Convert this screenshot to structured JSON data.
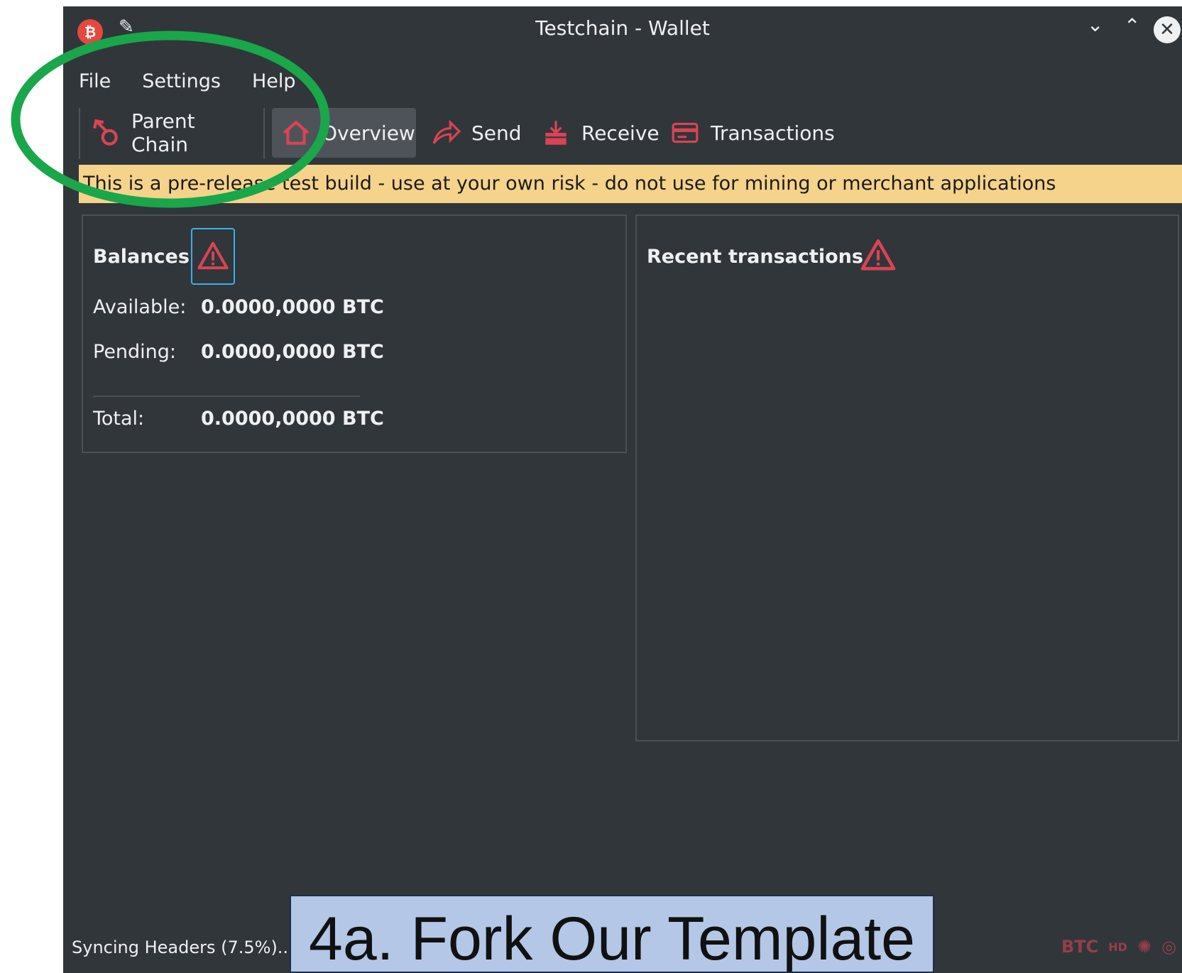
{
  "window": {
    "title": "Testchain - Wallet",
    "app_icon_glyph": "₿",
    "pin_icon": "pin-icon",
    "buttons": [
      "chevron-down-icon",
      "chevron-up-icon",
      "close-icon"
    ]
  },
  "menu": {
    "items": [
      {
        "label": "File"
      },
      {
        "label": "Settings"
      },
      {
        "label": "Help"
      }
    ]
  },
  "toolbar": {
    "parent_chain": "Parent Chain",
    "overview": "Overview",
    "send": "Send",
    "receive": "Receive",
    "transactions": "Transactions",
    "active": "Overview"
  },
  "warning": {
    "text": "This is a pre-release test build - use at your own risk - do not use for mining or merchant applications"
  },
  "balances": {
    "heading": "Balances",
    "available_label": "Available:",
    "available_value": "0.0000,0000 BTC",
    "pending_label": "Pending:",
    "pending_value": "0.0000,0000 BTC",
    "total_label": "Total:",
    "total_value": "0.0000,0000 BTC"
  },
  "recent": {
    "heading": "Recent transactions"
  },
  "status": {
    "sync_text": "Syncing Headers (7.5%)...",
    "unit_label": "BTC",
    "hd_label": "HD"
  },
  "overlay": {
    "caption": "4a. Fork Our Template"
  },
  "colors": {
    "window_bg": "#31363b",
    "accent_red": "#da4453",
    "warning_bg": "#f5d38a",
    "annotation_green": "#1aa64a",
    "caption_bg": "#b4c7e7"
  }
}
